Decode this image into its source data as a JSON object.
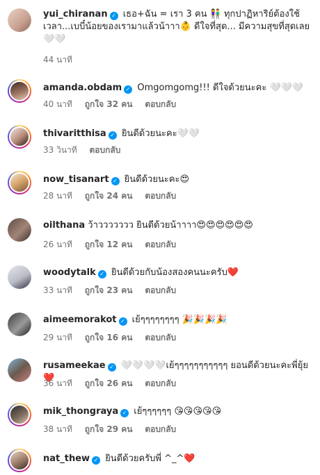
{
  "comments": [
    {
      "user": "yui_chiranan",
      "text": "เธอ+ฉัน = เรา 3 คน 👫 ทุกปาฏิหาริย์ต้องใช้เวลา...เบบี๋น้อยของเรามาแล้วน้าาา👶 ดีใจที่สุด... มีความสุขที่สุดเลย🤍🤍",
      "time": "44 นาที",
      "likes": "",
      "reply": ""
    },
    {
      "user": "amanda.obdam",
      "text": "Omgomgomg!!! ดีใจด้วยนะคะ 🤍🤍🤍",
      "time": "40 นาที",
      "likes": "ถูกใจ 32 คน",
      "reply": "ตอบกลับ"
    },
    {
      "user": "thivaritthisa",
      "text": "ยินดีด้วยนะคะ🤍🤍",
      "time": "33 วินาที",
      "likes": "",
      "reply": "ตอบกลับ"
    },
    {
      "user": "now_tisanart",
      "text": "ยินดีด้วยนะคะ😍",
      "time": "28 นาที",
      "likes": "ถูกใจ 24 คน",
      "reply": "ตอบกลับ"
    },
    {
      "user": "oilthana",
      "text": "ว้าววววววว ยินดีด้วยน้าาาา😍😍😍😍😍😍",
      "time": "26 นาที",
      "likes": "ถูกใจ 12 คน",
      "reply": "ตอบกลับ"
    },
    {
      "user": "woodytalk",
      "text": "ยินดีด้วยกับน้องสองคนนะครับ❤️",
      "time": "33 นาที",
      "likes": "ถูกใจ 23 คน",
      "reply": "ตอบกลับ"
    },
    {
      "user": "aimeemorakot",
      "text": "เย้ๆๆๆๆๆๆๆๆ 🎉🎉🎉🎉",
      "time": "29 นาที",
      "likes": "ถูกใจ 16 คน",
      "reply": "ตอบกลับ"
    },
    {
      "user": "rusameekae",
      "text": "🤍🤍🤍🤍เย้ๆๆๆๆๆๆๆๆๆๆๆ ยอนดีด้วยนะคะพี่ยุ้ย❤️",
      "time": "36 นาที",
      "likes": "ถูกใจ 26 คน",
      "reply": "ตอบกลับ"
    },
    {
      "user": "mik_thongraya",
      "text": "เย้ๆๆๆๆๆๆ 😘😘😘😘😘",
      "time": "38 นาที",
      "likes": "ถูกใจ 29 คน",
      "reply": "ตอบกลับ"
    },
    {
      "user": "nat_thew",
      "text": "ยินดีด้วยครับพี่ ^_^❤️",
      "time": "",
      "likes": "",
      "reply": ""
    }
  ],
  "verified_badge": "✓",
  "colors": {
    "verified": "#0095f6",
    "meta": "#737373",
    "text": "#262626"
  }
}
